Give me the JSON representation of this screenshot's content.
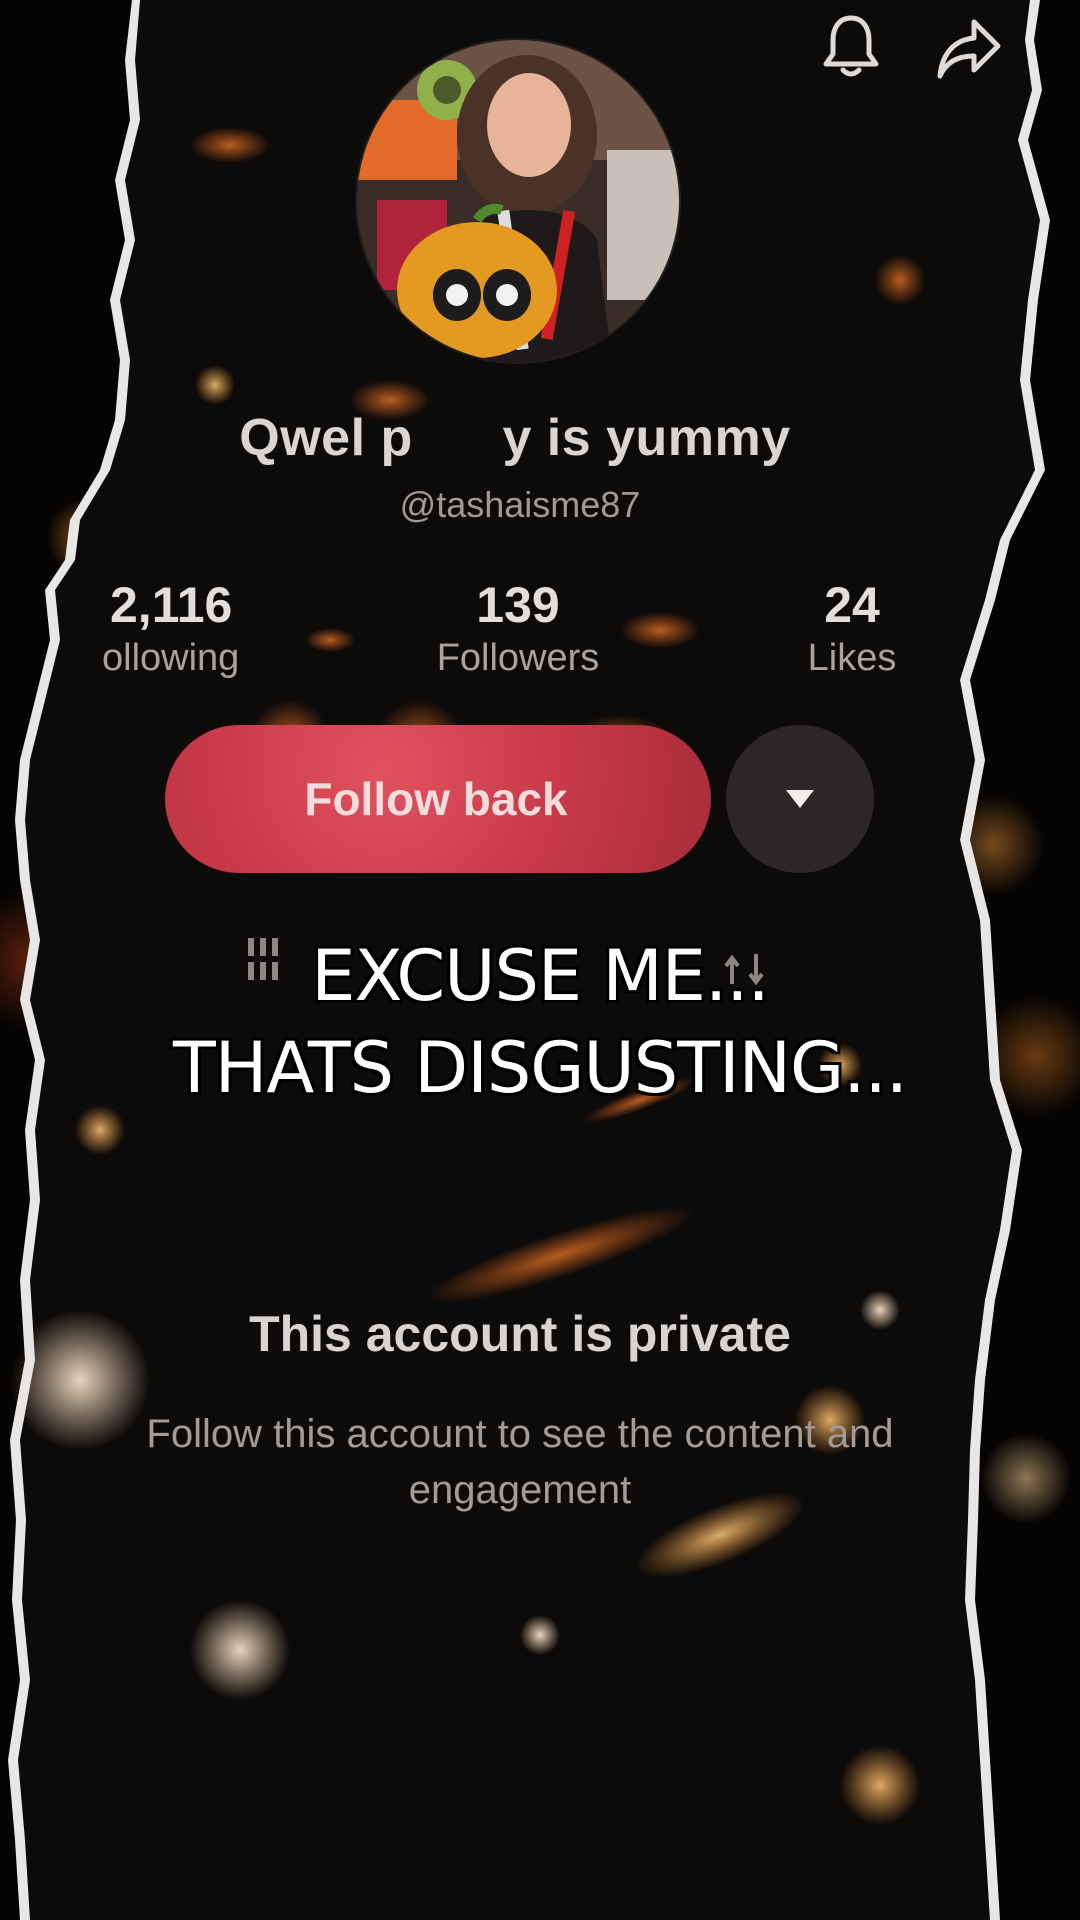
{
  "header": {
    "bell_icon": "bell-icon",
    "share_icon": "share-arrow-icon"
  },
  "profile": {
    "display_name": "Qwel p      y is yummy",
    "handle": "@tashaisme87"
  },
  "stats": [
    {
      "value": "2,116",
      "label": "ollowing"
    },
    {
      "value": "139",
      "label": "Followers"
    },
    {
      "value": "24",
      "label": "Likes"
    }
  ],
  "actions": {
    "follow_label": "Follow back",
    "dropdown_icon": "triangle-down-icon"
  },
  "caption": {
    "line1": "EXCUSE ME...",
    "line2": "THATS DISGUSTING..."
  },
  "private": {
    "title": "This account is private",
    "subtitle": "Follow this account to see the content and engagement"
  },
  "colors": {
    "follow_button": "#c63847",
    "dropdown_button": "#2b2726",
    "paper_bg": "#0d0b0a",
    "torn_edge": "#eeeeee"
  }
}
